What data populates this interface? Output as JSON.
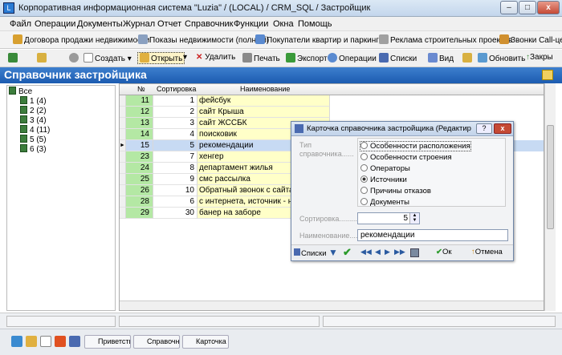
{
  "window": {
    "title": "Корпоративная информационная система \"Luzia\" / (LOCAL) / CRM_SQL / Застройщик",
    "app_icon": "L",
    "min_label": "–",
    "max_label": "□",
    "close_label": "x"
  },
  "menu": [
    "Файл",
    "Операции",
    "Документы",
    "Журнал",
    "Отчет",
    "Справочник",
    "Функции",
    "Окна",
    "Помощь"
  ],
  "favorites": [
    {
      "label": "Договора продажи недвижимости",
      "icon": "contract-icon",
      "color": "#d8a030"
    },
    {
      "label": "Показы недвижимости (полный)",
      "icon": "search-icon",
      "color": "#8aa0c0"
    },
    {
      "label": "Покупатели квартир и паркингов",
      "icon": "people-icon",
      "color": "#5a8ad0"
    },
    {
      "label": "Реклама строительных проектов",
      "icon": "ad-icon",
      "color": "#a0a0a0"
    },
    {
      "label": "Звонки Call-цен",
      "icon": "phone-icon",
      "color": "#d09030"
    }
  ],
  "toolbar": {
    "create": "Создать",
    "open": "Открыть",
    "delete": "Удалить",
    "print": "Печать",
    "export": "Экспорт",
    "operations": "Операции",
    "lists": "Списки",
    "view": "Вид",
    "refresh": "Обновить",
    "close": "Закры"
  },
  "header": {
    "title": "Справочник застройщика"
  },
  "tree": {
    "root": "Все",
    "items": [
      "1 (4)",
      "2 (2)",
      "3 (4)",
      "4 (11)",
      "5 (5)",
      "6 (3)"
    ]
  },
  "grid": {
    "columns": {
      "num": "№",
      "sort": "Сортировка",
      "name": "Наименование"
    },
    "rows": [
      {
        "num": "11",
        "sort": "1",
        "name": "фейсбук"
      },
      {
        "num": "12",
        "sort": "2",
        "name": "сайт Крыша"
      },
      {
        "num": "13",
        "sort": "3",
        "name": "сайт ЖССБК"
      },
      {
        "num": "14",
        "sort": "4",
        "name": "поисковик"
      },
      {
        "num": "15",
        "sort": "5",
        "name": "рекомендации"
      },
      {
        "num": "23",
        "sort": "7",
        "name": "хенгер"
      },
      {
        "num": "24",
        "sort": "8",
        "name": "департамент жилья"
      },
      {
        "num": "25",
        "sort": "9",
        "name": "смс рассылка"
      },
      {
        "num": "26",
        "sort": "10",
        "name": "Обратный звонок с сайта"
      },
      {
        "num": "28",
        "sort": "6",
        "name": "с интернета, источник - неиз"
      },
      {
        "num": "29",
        "sort": "30",
        "name": "банер на заборе"
      }
    ],
    "selected_index": 4,
    "row_pointer": "►"
  },
  "dialog": {
    "title": "Карточка справочника застройщика (Редактиро...",
    "help_label": "?",
    "close_label": "x",
    "type_label": "Тип справочника.........",
    "types": [
      "Особенности расположения",
      "Особенности строения",
      "Операторы",
      "Источники",
      "Причины отказов",
      "Документы"
    ],
    "selected_type_index": 3,
    "sort_label": "Сортировка.........",
    "sort_value": "5",
    "name_label": "Наименование.........",
    "name_value": "рекомендации",
    "lists_label": "Списки",
    "ok_label": "Ок",
    "cancel_label": "Отмена"
  },
  "taskbar": [
    "Приветстви..",
    "Справочник..",
    "Карточка с.."
  ]
}
